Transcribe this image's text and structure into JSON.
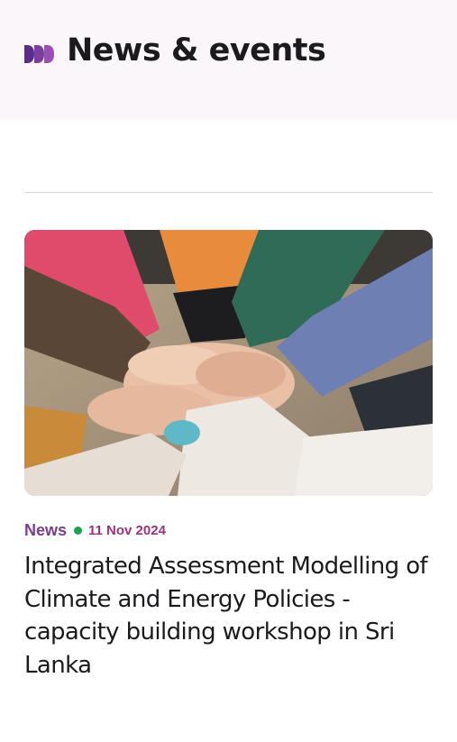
{
  "header": {
    "title": "News & events",
    "icon": "triple-chevron-icon",
    "accent_color": "#7b3fa0"
  },
  "card": {
    "image_alt": "Hands stacked together in a circle",
    "category": "News",
    "date": "11 Nov 2024",
    "title": "Integrated Assessment Modelling of Climate and Energy Policies - capacity building workshop in Sri Lanka",
    "category_color": "#7a3d8f",
    "dot_color": "#1aa34a"
  }
}
